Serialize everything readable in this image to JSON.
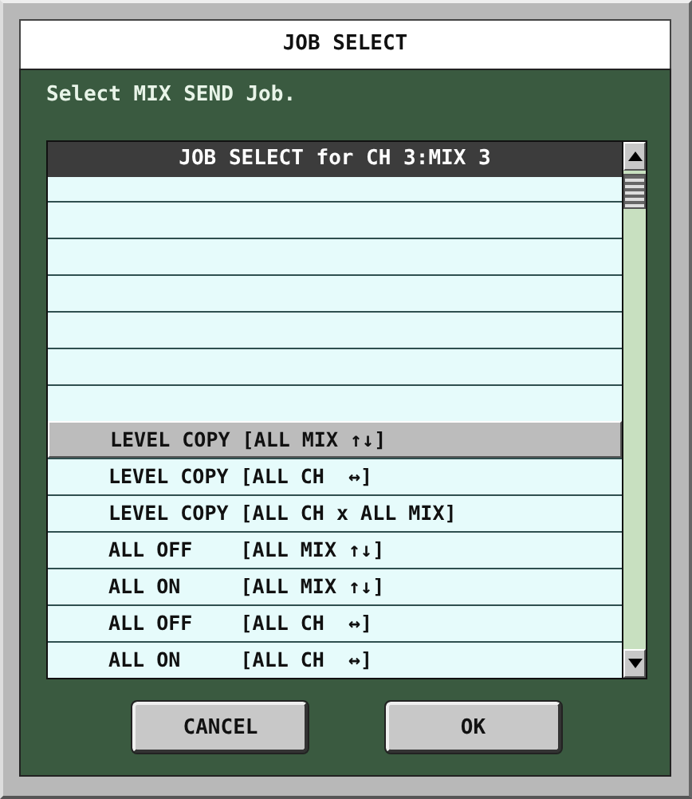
{
  "window": {
    "title": "JOB SELECT"
  },
  "message": "Select MIX SEND  Job.",
  "list": {
    "header": "JOB SELECT for CH 3:MIX 3",
    "rows": [
      {
        "label": "LEVEL COPY [ALL MIX ↑↓]",
        "selected": true
      },
      {
        "label": "LEVEL COPY [ALL CH  ↔]",
        "selected": false
      },
      {
        "label": "LEVEL COPY [ALL CH x ALL MIX]",
        "selected": false
      },
      {
        "label": "ALL OFF    [ALL MIX ↑↓]",
        "selected": false
      },
      {
        "label": "ALL ON     [ALL MIX ↑↓]",
        "selected": false
      },
      {
        "label": "ALL OFF    [ALL CH  ↔]",
        "selected": false
      },
      {
        "label": "ALL ON     [ALL CH  ↔]",
        "selected": false
      }
    ]
  },
  "buttons": [
    "CANCEL",
    "OK"
  ]
}
